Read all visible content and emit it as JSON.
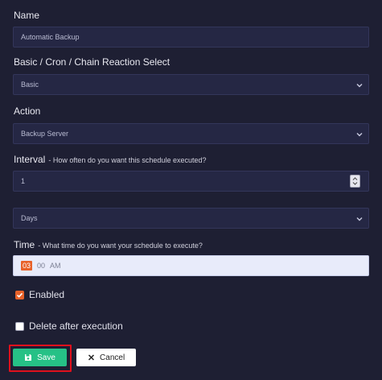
{
  "name": {
    "label": "Name",
    "value": "Automatic Backup"
  },
  "type_select": {
    "label": "Basic / Cron / Chain Reaction Select",
    "value": "Basic"
  },
  "action": {
    "label": "Action",
    "value": "Backup Server"
  },
  "interval": {
    "label": "Interval",
    "hint": "- How often do you want this schedule executed?",
    "value": "1",
    "unit": "Days"
  },
  "time": {
    "label": "Time",
    "hint": "- What time do you want your schedule to execute?",
    "hour": "03",
    "minute": "00",
    "period": "AM"
  },
  "enabled": {
    "label": "Enabled",
    "checked": true
  },
  "delete_after": {
    "label": "Delete after execution",
    "checked": false
  },
  "buttons": {
    "save": "Save",
    "cancel": "Cancel"
  },
  "colors": {
    "background": "#1e1f33",
    "field": "#252744",
    "accent": "#e8622a",
    "save": "#26c186",
    "highlight": "#e0101c"
  },
  "icons": {
    "save": "floppy-disk-icon",
    "cancel": "close-icon",
    "chevron": "chevron-down-icon",
    "stepper": "spinner-icon",
    "checkbox": "checkmark-icon"
  }
}
